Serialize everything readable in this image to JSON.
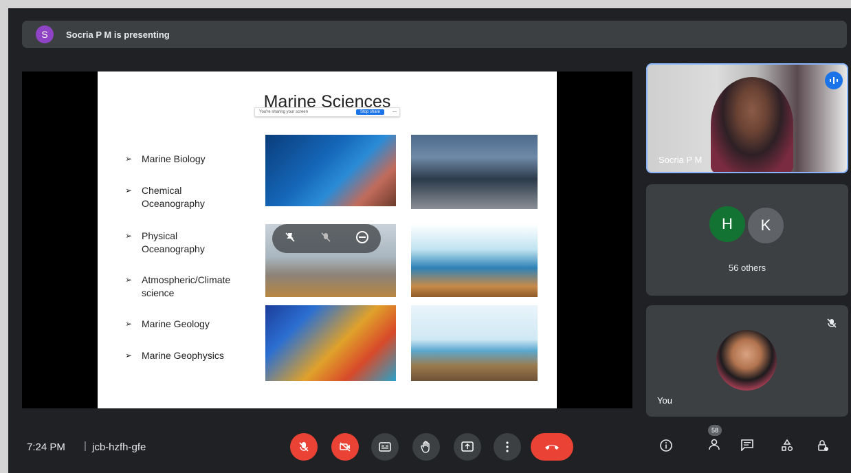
{
  "presenting_bar": {
    "avatar_letter": "S",
    "text": "Socria P M is presenting"
  },
  "slide": {
    "title": "Marine Sciences",
    "share_prompt": "You're sharing your screen",
    "stop_label": "Stop share",
    "hide_label": "—",
    "bullets": [
      "Marine Biology",
      "Chemical Oceanography",
      "Physical Oceanography",
      "Atmospheric/Climate science",
      "Marine Geology",
      "Marine Geophysics"
    ]
  },
  "participants": {
    "presenter_name": "Socria P M",
    "other_avatars": [
      "H",
      "K"
    ],
    "others_label": "56 others",
    "you_label": "You"
  },
  "bottom_bar": {
    "time": "7:24 PM",
    "separator": "|",
    "meeting_code": "jcb-hzfh-gfe",
    "participants_badge": "58"
  },
  "colors": {
    "background": "#202124",
    "tile": "#3c4043",
    "accent_blue": "#1a73e8",
    "danger_red": "#ea4335"
  }
}
